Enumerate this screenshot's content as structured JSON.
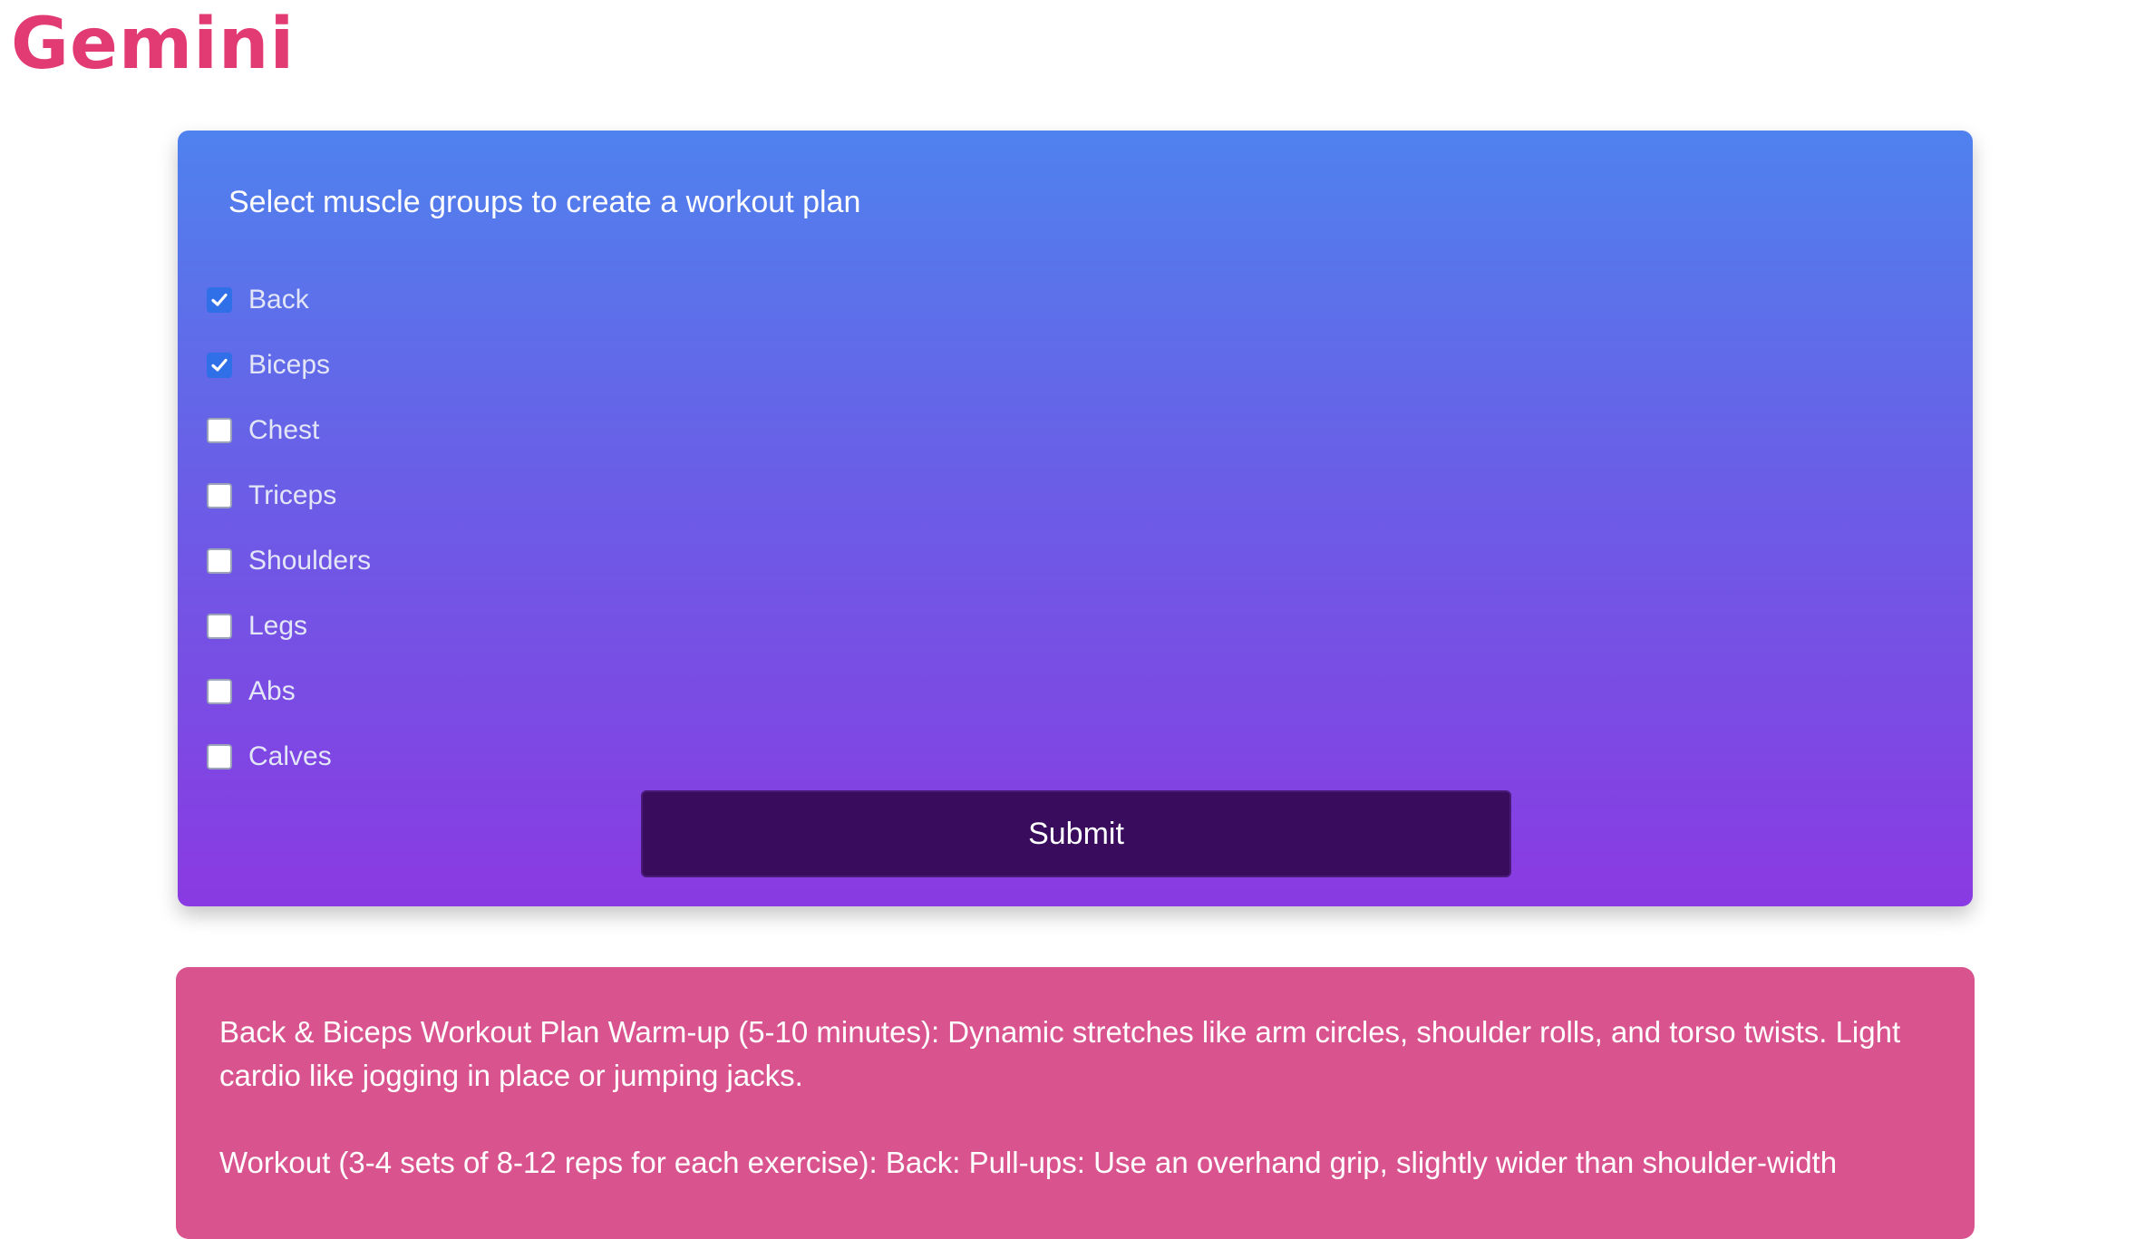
{
  "app": {
    "logo_text": "Gemini",
    "logo_color": "#e23b74"
  },
  "form": {
    "title": "Select muscle groups to create a workout plan",
    "options": [
      {
        "label": "Back",
        "checked": true
      },
      {
        "label": "Biceps",
        "checked": true
      },
      {
        "label": "Chest",
        "checked": false
      },
      {
        "label": "Triceps",
        "checked": false
      },
      {
        "label": "Shoulders",
        "checked": false
      },
      {
        "label": "Legs",
        "checked": false
      },
      {
        "label": "Abs",
        "checked": false
      },
      {
        "label": "Calves",
        "checked": false
      }
    ],
    "submit_label": "Submit",
    "gradient_top": "#4f82ee",
    "gradient_bottom": "#8a3ae2",
    "submit_color": "#390c5e"
  },
  "result": {
    "background": "#d9548f",
    "paragraphs": [
      "Back & Biceps Workout Plan Warm-up (5-10 minutes): Dynamic stretches like arm circles, shoulder rolls, and torso twists. Light cardio like jogging in place or jumping jacks.",
      "Workout (3-4 sets of 8-12 reps for each exercise): Back: Pull-ups: Use an overhand grip, slightly wider than shoulder-width"
    ]
  }
}
